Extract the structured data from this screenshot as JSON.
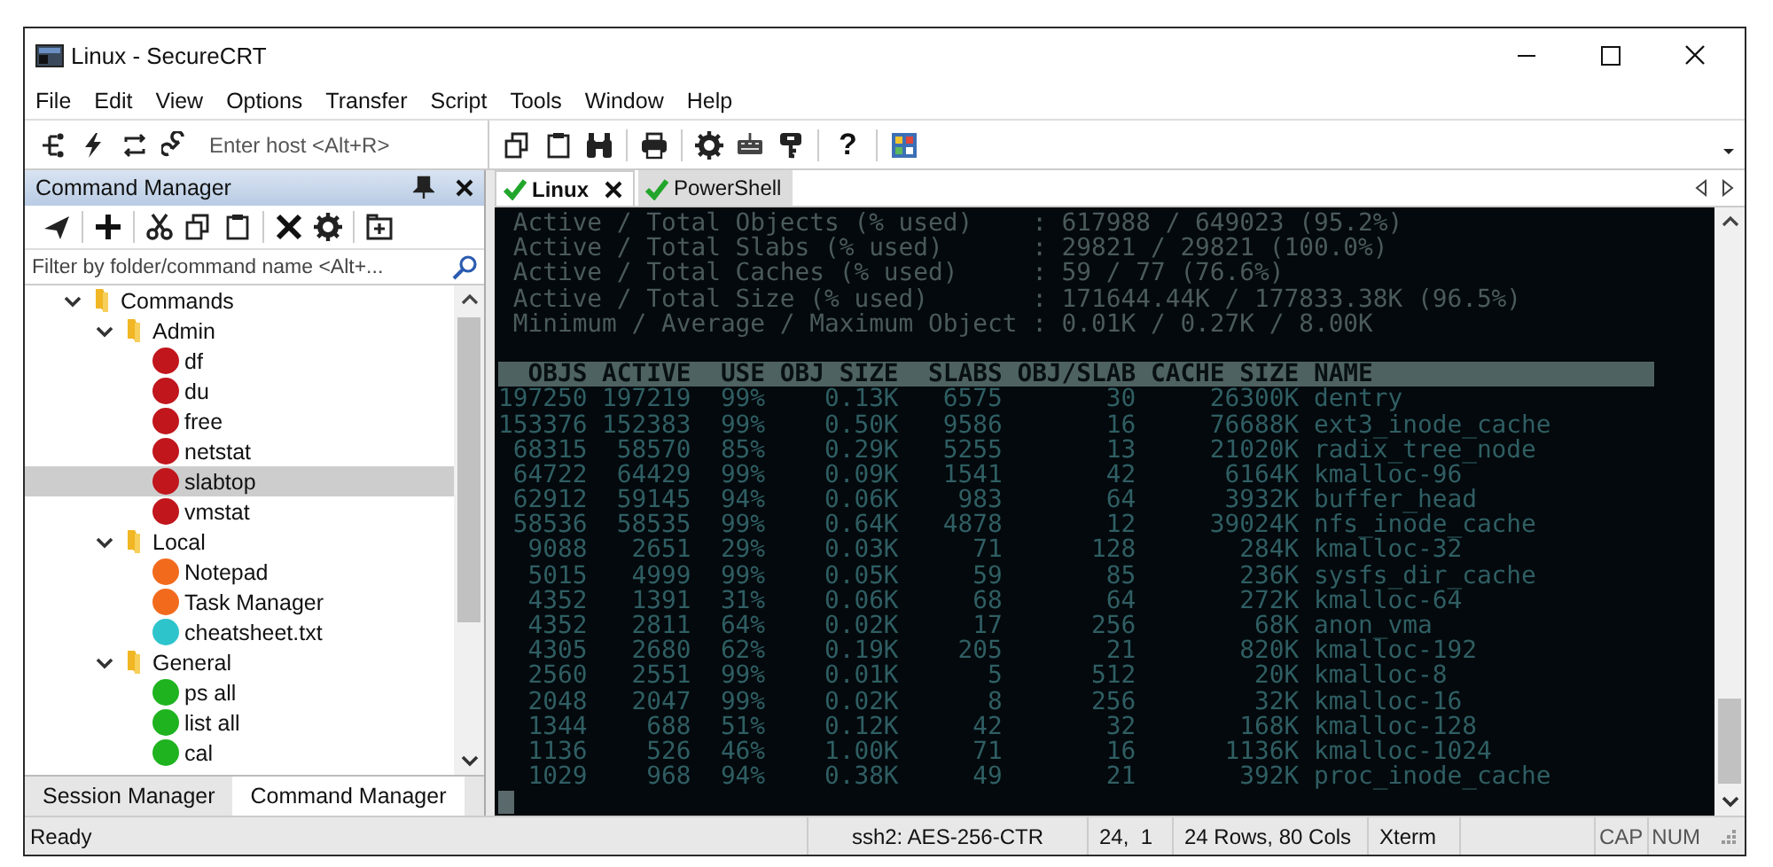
{
  "window": {
    "title": "Linux - SecureCRT"
  },
  "menu": [
    "File",
    "Edit",
    "View",
    "Options",
    "Transfer",
    "Script",
    "Tools",
    "Window",
    "Help"
  ],
  "toolbar": {
    "host_field": {
      "placeholder": "Enter host <Alt+R>"
    },
    "help_button": "?"
  },
  "command_manager": {
    "title": "Command Manager",
    "filter": {
      "placeholder": "Filter by folder/command name <Alt+..."
    },
    "tree": [
      {
        "label": "Commands",
        "kind": "folder",
        "expanded": true,
        "selected": false,
        "children": [
          {
            "label": "Admin",
            "kind": "folder",
            "expanded": true,
            "selected": false,
            "children": [
              {
                "label": "df",
                "kind": "command",
                "color": "#c0161c",
                "selected": false
              },
              {
                "label": "du",
                "kind": "command",
                "color": "#c0161c",
                "selected": false
              },
              {
                "label": "free",
                "kind": "command",
                "color": "#c0161c",
                "selected": false
              },
              {
                "label": "netstat",
                "kind": "command",
                "color": "#c0161c",
                "selected": false
              },
              {
                "label": "slabtop",
                "kind": "command",
                "color": "#c0161c",
                "selected": true
              },
              {
                "label": "vmstat",
                "kind": "command",
                "color": "#c0161c",
                "selected": false
              }
            ]
          },
          {
            "label": "Local",
            "kind": "folder",
            "expanded": true,
            "selected": false,
            "children": [
              {
                "label": "Notepad",
                "kind": "command",
                "color": "#f26b1d",
                "selected": false
              },
              {
                "label": "Task Manager",
                "kind": "command",
                "color": "#f26b1d",
                "selected": false
              },
              {
                "label": "cheatsheet.txt",
                "kind": "command",
                "color": "#2ec4cc",
                "selected": false
              }
            ]
          },
          {
            "label": "General",
            "kind": "folder",
            "expanded": true,
            "selected": false,
            "children": [
              {
                "label": "ps all",
                "kind": "command",
                "color": "#1fb31f",
                "selected": false
              },
              {
                "label": "list all",
                "kind": "command",
                "color": "#1fb31f",
                "selected": false
              },
              {
                "label": "cal",
                "kind": "command",
                "color": "#1fb31f",
                "selected": false
              }
            ]
          }
        ]
      }
    ]
  },
  "panel_tabs": [
    {
      "label": "Session Manager",
      "selected": false
    },
    {
      "label": "Command Manager",
      "selected": true
    }
  ],
  "session_tabs": [
    {
      "label": "Linux",
      "selected": true
    },
    {
      "label": "PowerShell",
      "selected": false
    }
  ],
  "terminal": {
    "lines": [
      {
        "kind": "stat",
        "text": " Active / Total Objects (% used)    : 617988 / 649023 (95.2%)"
      },
      {
        "kind": "stat",
        "text": " Active / Total Slabs (% used)      : 29821 / 29821 (100.0%)"
      },
      {
        "kind": "stat",
        "text": " Active / Total Caches (% used)     : 59 / 77 (76.6%)"
      },
      {
        "kind": "stat",
        "text": " Active / Total Size (% used)       : 171644.44K / 177833.38K (96.5%)"
      },
      {
        "kind": "stat",
        "text": " Minimum / Average / Maximum Object : 0.01K / 0.27K / 8.00K"
      },
      {
        "kind": "header",
        "text": "  OBJS ACTIVE  USE OBJ SIZE  SLABS OBJ/SLAB CACHE SIZE NAME"
      },
      {
        "kind": "row",
        "text": "197250 197219  99%    0.13K   6575       30     26300K dentry"
      },
      {
        "kind": "row",
        "text": "153376 152383  99%    0.50K   9586       16     76688K ext3_inode_cache"
      },
      {
        "kind": "row",
        "text": " 68315  58570  85%    0.29K   5255       13     21020K radix_tree_node"
      },
      {
        "kind": "row",
        "text": " 64722  64429  99%    0.09K   1541       42      6164K kmalloc-96"
      },
      {
        "kind": "row",
        "text": " 62912  59145  94%    0.06K    983       64      3932K buffer_head"
      },
      {
        "kind": "row",
        "text": " 58536  58535  99%    0.64K   4878       12     39024K nfs_inode_cache"
      },
      {
        "kind": "row",
        "text": "  9088   2651  29%    0.03K     71      128       284K kmalloc-32"
      },
      {
        "kind": "row",
        "text": "  5015   4999  99%    0.05K     59       85       236K sysfs_dir_cache"
      },
      {
        "kind": "row",
        "text": "  4352   1391  31%    0.06K     68       64       272K kmalloc-64"
      },
      {
        "kind": "row",
        "text": "  4352   2811  64%    0.02K     17      256        68K anon_vma"
      },
      {
        "kind": "row",
        "text": "  4305   2680  62%    0.19K    205       21       820K kmalloc-192"
      },
      {
        "kind": "row",
        "text": "  2560   2551  99%    0.01K      5      512        20K kmalloc-8"
      },
      {
        "kind": "row",
        "text": "  2048   2047  99%    0.02K      8      256        32K kmalloc-16"
      },
      {
        "kind": "row",
        "text": "  1344    688  51%    0.12K     42       32       168K kmalloc-128"
      },
      {
        "kind": "row",
        "text": "  1136    526  46%    1.00K     71       16      1136K kmalloc-1024"
      },
      {
        "kind": "row",
        "text": "  1029    968  94%    0.38K     49       21       392K proc_inode_cache"
      }
    ]
  },
  "status_bar": {
    "message": "Ready",
    "fields": [
      "ssh2: AES-256-CTR",
      "24,  1",
      "24 Rows, 80 Cols",
      "Xterm",
      "CAP",
      "NUM"
    ]
  }
}
